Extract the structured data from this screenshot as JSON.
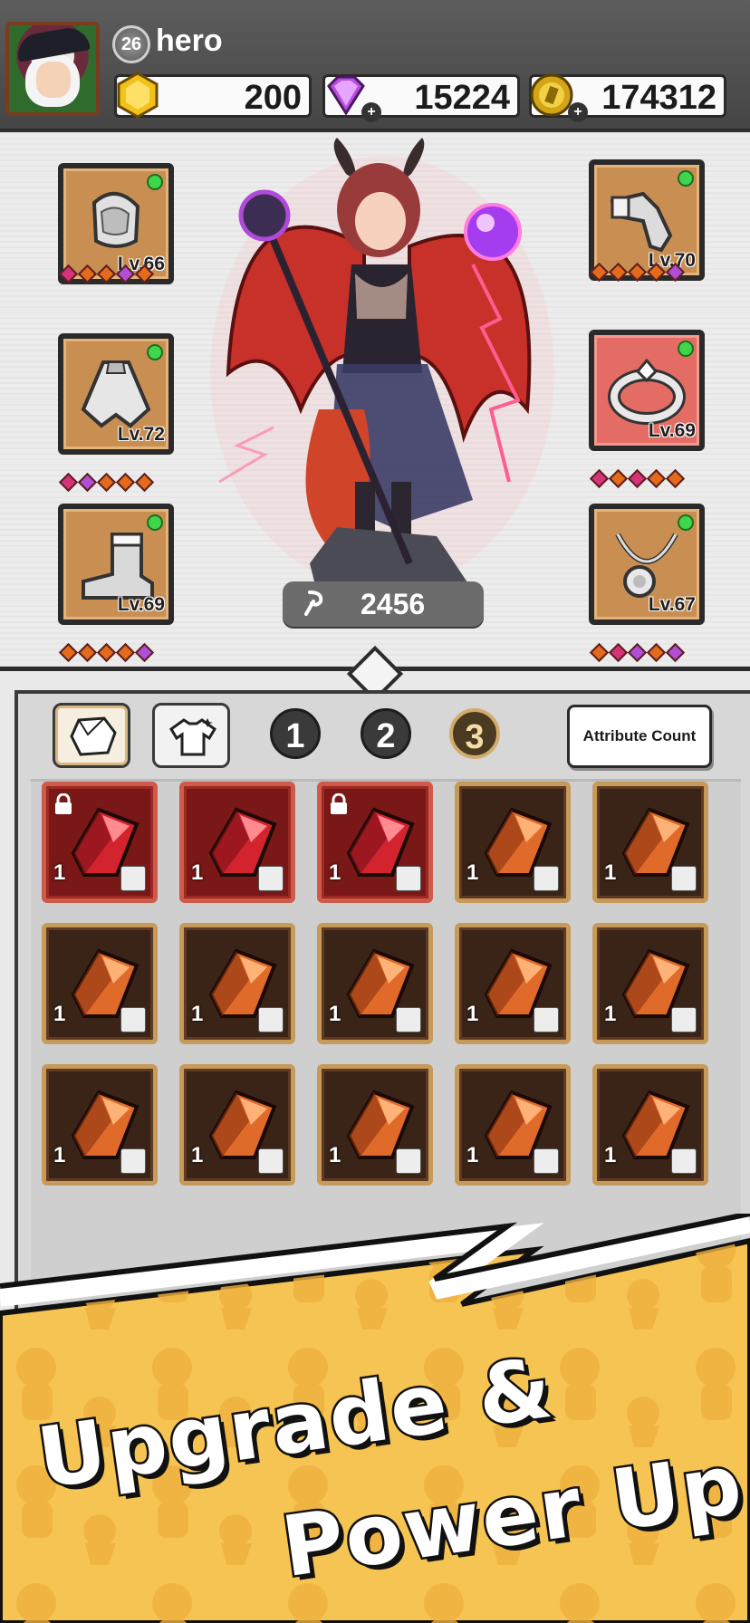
{
  "player": {
    "level": "26",
    "name": "hero"
  },
  "resources": {
    "gold": "200",
    "gems": "15224",
    "coins": "174312"
  },
  "equipment": {
    "left": [
      {
        "name": "helmet",
        "level_label": "Lv.66",
        "gems": [
          "m",
          "o",
          "o",
          "p",
          "o"
        ]
      },
      {
        "name": "cape",
        "level_label": "Lv.72",
        "gems": [
          "m",
          "p",
          "o",
          "o",
          "o"
        ]
      },
      {
        "name": "boots",
        "level_label": "Lv.69",
        "gems": [
          "o",
          "o",
          "o",
          "o",
          "p"
        ]
      }
    ],
    "right": [
      {
        "name": "gauntlet",
        "level_label": "Lv.70",
        "gems": [
          "o",
          "o",
          "o",
          "o",
          "p"
        ]
      },
      {
        "name": "ring",
        "level_label": "Lv.69",
        "gems": [
          "m",
          "o",
          "m",
          "o",
          "o"
        ]
      },
      {
        "name": "necklace",
        "level_label": "Lv.67",
        "gems": [
          "o",
          "m",
          "p",
          "o",
          "p"
        ]
      }
    ]
  },
  "hero": {
    "power": "2456"
  },
  "inventory": {
    "pages": [
      "1",
      "2",
      "3"
    ],
    "active_page": "3",
    "attribute_button": "Attribute Count",
    "items": [
      {
        "kind": "red",
        "count": "1",
        "locked": true
      },
      {
        "kind": "red",
        "count": "1",
        "locked": false
      },
      {
        "kind": "red",
        "count": "1",
        "locked": true
      },
      {
        "kind": "orange",
        "count": "1",
        "locked": false
      },
      {
        "kind": "orange",
        "count": "1",
        "locked": false
      },
      {
        "kind": "orange",
        "count": "1",
        "locked": false
      },
      {
        "kind": "orange",
        "count": "1",
        "locked": false
      },
      {
        "kind": "orange",
        "count": "1",
        "locked": false
      },
      {
        "kind": "orange",
        "count": "1",
        "locked": false
      },
      {
        "kind": "orange",
        "count": "1",
        "locked": false
      },
      {
        "kind": "orange",
        "count": "1",
        "locked": false
      },
      {
        "kind": "orange",
        "count": "1",
        "locked": false
      },
      {
        "kind": "orange",
        "count": "1",
        "locked": false
      },
      {
        "kind": "orange",
        "count": "1",
        "locked": false
      },
      {
        "kind": "orange",
        "count": "1",
        "locked": false
      }
    ]
  },
  "banner": {
    "line1": "Upgrade &",
    "line2": "Power Up"
  },
  "colors": {
    "gold": "#f2c21a",
    "gem_purple": "#b64fe0",
    "slot_brown": "#c98f52",
    "banner_yellow": "#f6c452"
  }
}
